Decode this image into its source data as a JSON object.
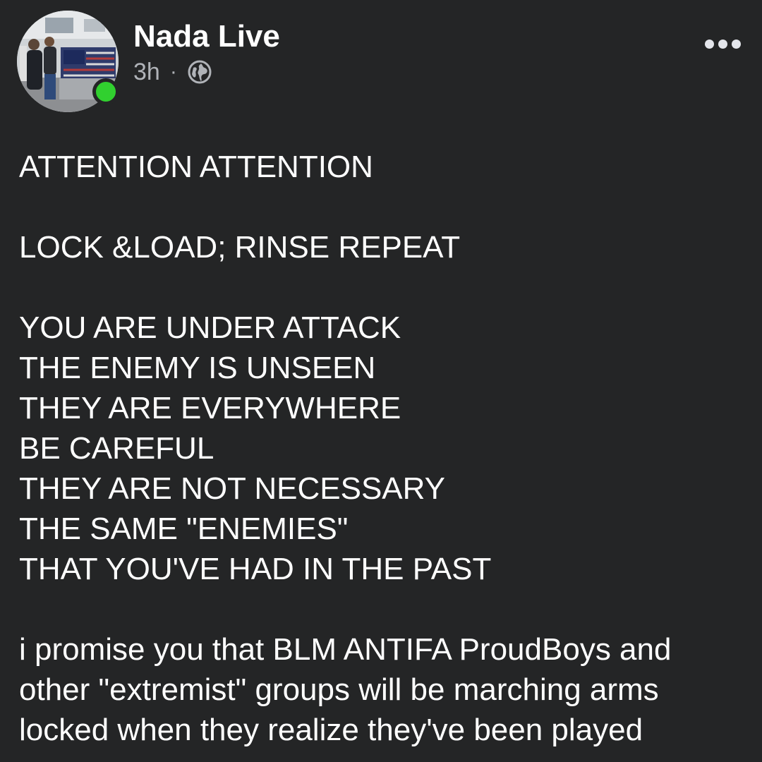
{
  "post": {
    "author": "Nada Live",
    "time": "3h",
    "separator": "·",
    "audience_icon": "globe-icon",
    "more_icon": "more-options-icon",
    "online_color": "#31d02f",
    "paragraphs": [
      [
        "ATTENTION ATTENTION"
      ],
      [
        "LOCK &LOAD; RINSE REPEAT"
      ],
      [
        "YOU ARE UNDER ATTACK",
        "THE ENEMY IS UNSEEN",
        "THEY ARE EVERYWHERE",
        "BE CAREFUL",
        "THEY ARE NOT NECESSARY",
        "THE SAME \"ENEMIES\"",
        "THAT YOU'VE HAD IN THE PAST"
      ],
      [
        "i promise you that BLM ANTIFA ProudBoys and",
        "other \"extremist\" groups will be marching arms",
        "locked when they realize they've been played"
      ]
    ]
  }
}
